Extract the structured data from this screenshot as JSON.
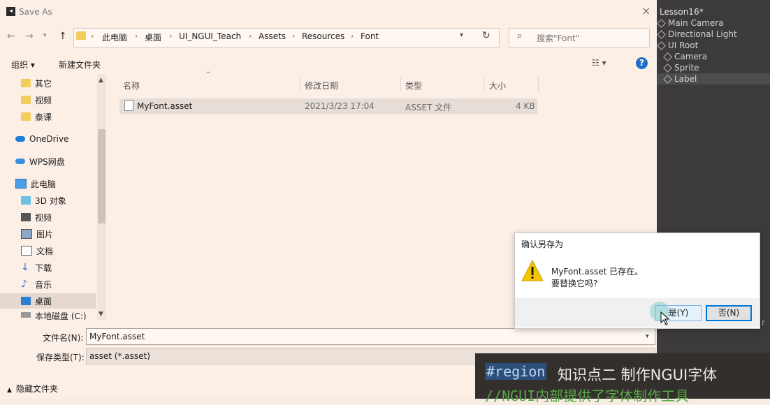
{
  "unity": {
    "scene_title": "Lesson16*",
    "hierarchy": [
      "Main Camera",
      "Directional Light",
      "UI Root",
      "Camera",
      "Sprite",
      "Label"
    ],
    "right_clip": "r"
  },
  "dialog": {
    "title": "Save As",
    "close": "×",
    "address_path": [
      "此电脑",
      "桌面",
      "UI_NGUI_Teach",
      "Assets",
      "Resources",
      "Font"
    ],
    "search_placeholder": "搜索\"Font\"",
    "toolbar": {
      "organize": "组织 ▾",
      "new_folder": "新建文件夹"
    },
    "sidebar": [
      {
        "label": "其它",
        "icon": "folder-icon"
      },
      {
        "label": "视频",
        "icon": "folder-icon"
      },
      {
        "label": "泰课",
        "icon": "folder-icon"
      },
      {
        "label": "OneDrive",
        "icon": "cloud-icon"
      },
      {
        "label": "WPS网盘",
        "icon": "cloud-icon"
      },
      {
        "label": "此电脑",
        "icon": "computer-icon"
      },
      {
        "label": "3D 对象",
        "icon": "cube-icon"
      },
      {
        "label": "视频",
        "icon": "video-icon"
      },
      {
        "label": "图片",
        "icon": "picture-icon"
      },
      {
        "label": "文档",
        "icon": "document-icon"
      },
      {
        "label": "下载",
        "icon": "download-icon"
      },
      {
        "label": "音乐",
        "icon": "music-icon"
      },
      {
        "label": "桌面",
        "icon": "desktop-icon"
      },
      {
        "label": "本地磁盘 (C:)",
        "icon": "drive-icon"
      }
    ],
    "columns": {
      "name": "名称",
      "date": "修改日期",
      "type": "类型",
      "size": "大小"
    },
    "files": [
      {
        "name": "MyFont.asset",
        "date": "2021/3/23 17:04",
        "type": "ASSET 文件",
        "size": "4 KB"
      }
    ],
    "filename_label": "文件名(N):",
    "filename_value": "MyFont.asset",
    "filetype_label": "保存类型(T):",
    "filetype_value": "asset (*.asset)",
    "hide_folders": "隐藏文件夹"
  },
  "confirm": {
    "title": "确认另存为",
    "line1": "MyFont.asset 已存在。",
    "line2": "要替换它吗?",
    "yes": "是(Y)",
    "no": "否(N)"
  },
  "code": {
    "keyword": "#region",
    "heading": "知识点二  制作NGUI字体",
    "comment": "//NGUI内部提供了字体制作工具"
  }
}
